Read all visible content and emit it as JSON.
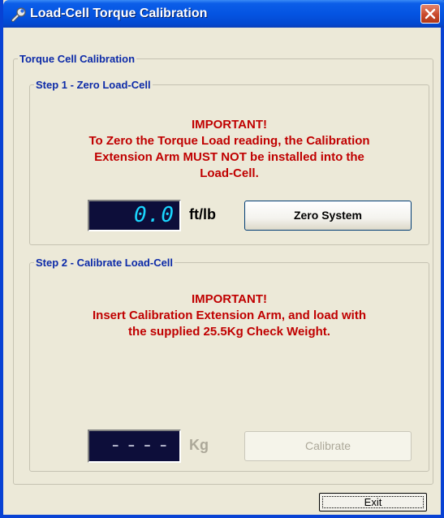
{
  "window": {
    "title": "Load-Cell Torque Calibration"
  },
  "group": {
    "title": "Torque Cell Calibration"
  },
  "step1": {
    "title": "Step 1 - Zero Load-Cell",
    "important": "IMPORTANT!",
    "message_line1": "To Zero the Torque Load reading, the Calibration",
    "message_line2": "Extension Arm MUST NOT be installed into the",
    "message_line3": "Load-Cell.",
    "reading": "0.0",
    "unit": "ft/lb",
    "button_label": "Zero System"
  },
  "step2": {
    "title": "Step 2 - Calibrate Load-Cell",
    "important": "IMPORTANT!",
    "message_line1": "Insert Calibration Extension Arm, and load with",
    "message_line2": "the supplied  25.5Kg Check Weight.",
    "reading": "----",
    "unit": "Kg",
    "button_label": "Calibrate"
  },
  "footer": {
    "exit_label": "Exit"
  },
  "colors": {
    "title_bar": "#0454e2",
    "warning_text": "#c00000",
    "group_title": "#0c2aa8",
    "lcd_background": "#0d0e3a",
    "lcd_digits": "#1ad6ff"
  },
  "icons": {
    "title": "wrench-icon",
    "close": "close-icon"
  }
}
